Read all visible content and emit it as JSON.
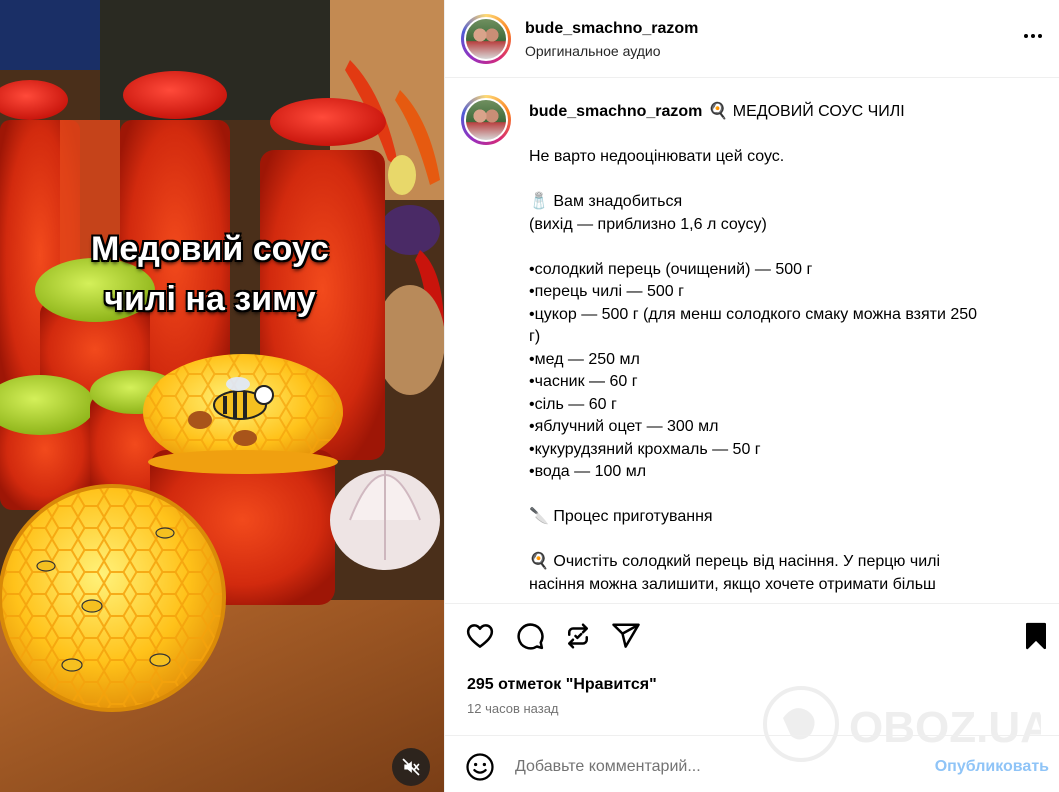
{
  "media": {
    "overlay_line1": "Медовий соус",
    "overlay_line2": "чилі на зиму",
    "mute_icon": "speaker-muted-icon"
  },
  "post": {
    "username": "bude_smachno_razom",
    "audio_label": "Оригинальное аудио",
    "more_icon": "more-horizontal-icon"
  },
  "caption": {
    "username": "bude_smachno_razom",
    "lines": [
      "🍳 МЕДОВИЙ СОУС ЧИЛІ",
      "",
      "Не варто недооцінювати цей соус.",
      "",
      "🧂 Вам знадобиться",
      "(вихід — приблизно 1,6 л соусу)",
      "",
      "•солодкий перець (очищений) — 500 г",
      "•перець чилі — 500 г",
      "•цукор — 500 г (для менш солодкого смаку можна взяти 250",
      "г)",
      "•мед — 250 мл",
      "•часник — 60 г",
      "•сіль — 60 г",
      "•яблучний оцет — 300 мл",
      "•кукурудзяний крохмаль — 50 г",
      "•вода — 100 мл",
      "",
      "🔪 Процес приготування",
      "",
      "🍳 Очистіть солодкий перець від насіння. У перцю чилі",
      "насіння можна залишити, якщо хочете отримати більш"
    ]
  },
  "actions": {
    "like_icon": "heart-icon",
    "comment_icon": "comment-icon",
    "repost_icon": "repost-icon",
    "share_icon": "send-icon",
    "save_icon": "bookmark-icon"
  },
  "likes_text": "295 отметок \"Нравится\"",
  "time_text": "12 часов назад",
  "comment": {
    "placeholder": "Добавьте комментарий...",
    "publish_label": "Опубликовать",
    "emoji_icon": "smiley-icon"
  },
  "watermark": {
    "text": "OBOZ.UA"
  },
  "colors": {
    "publish": "#8fc4f7",
    "secondary_text": "#737373",
    "divider": "#efefef"
  }
}
